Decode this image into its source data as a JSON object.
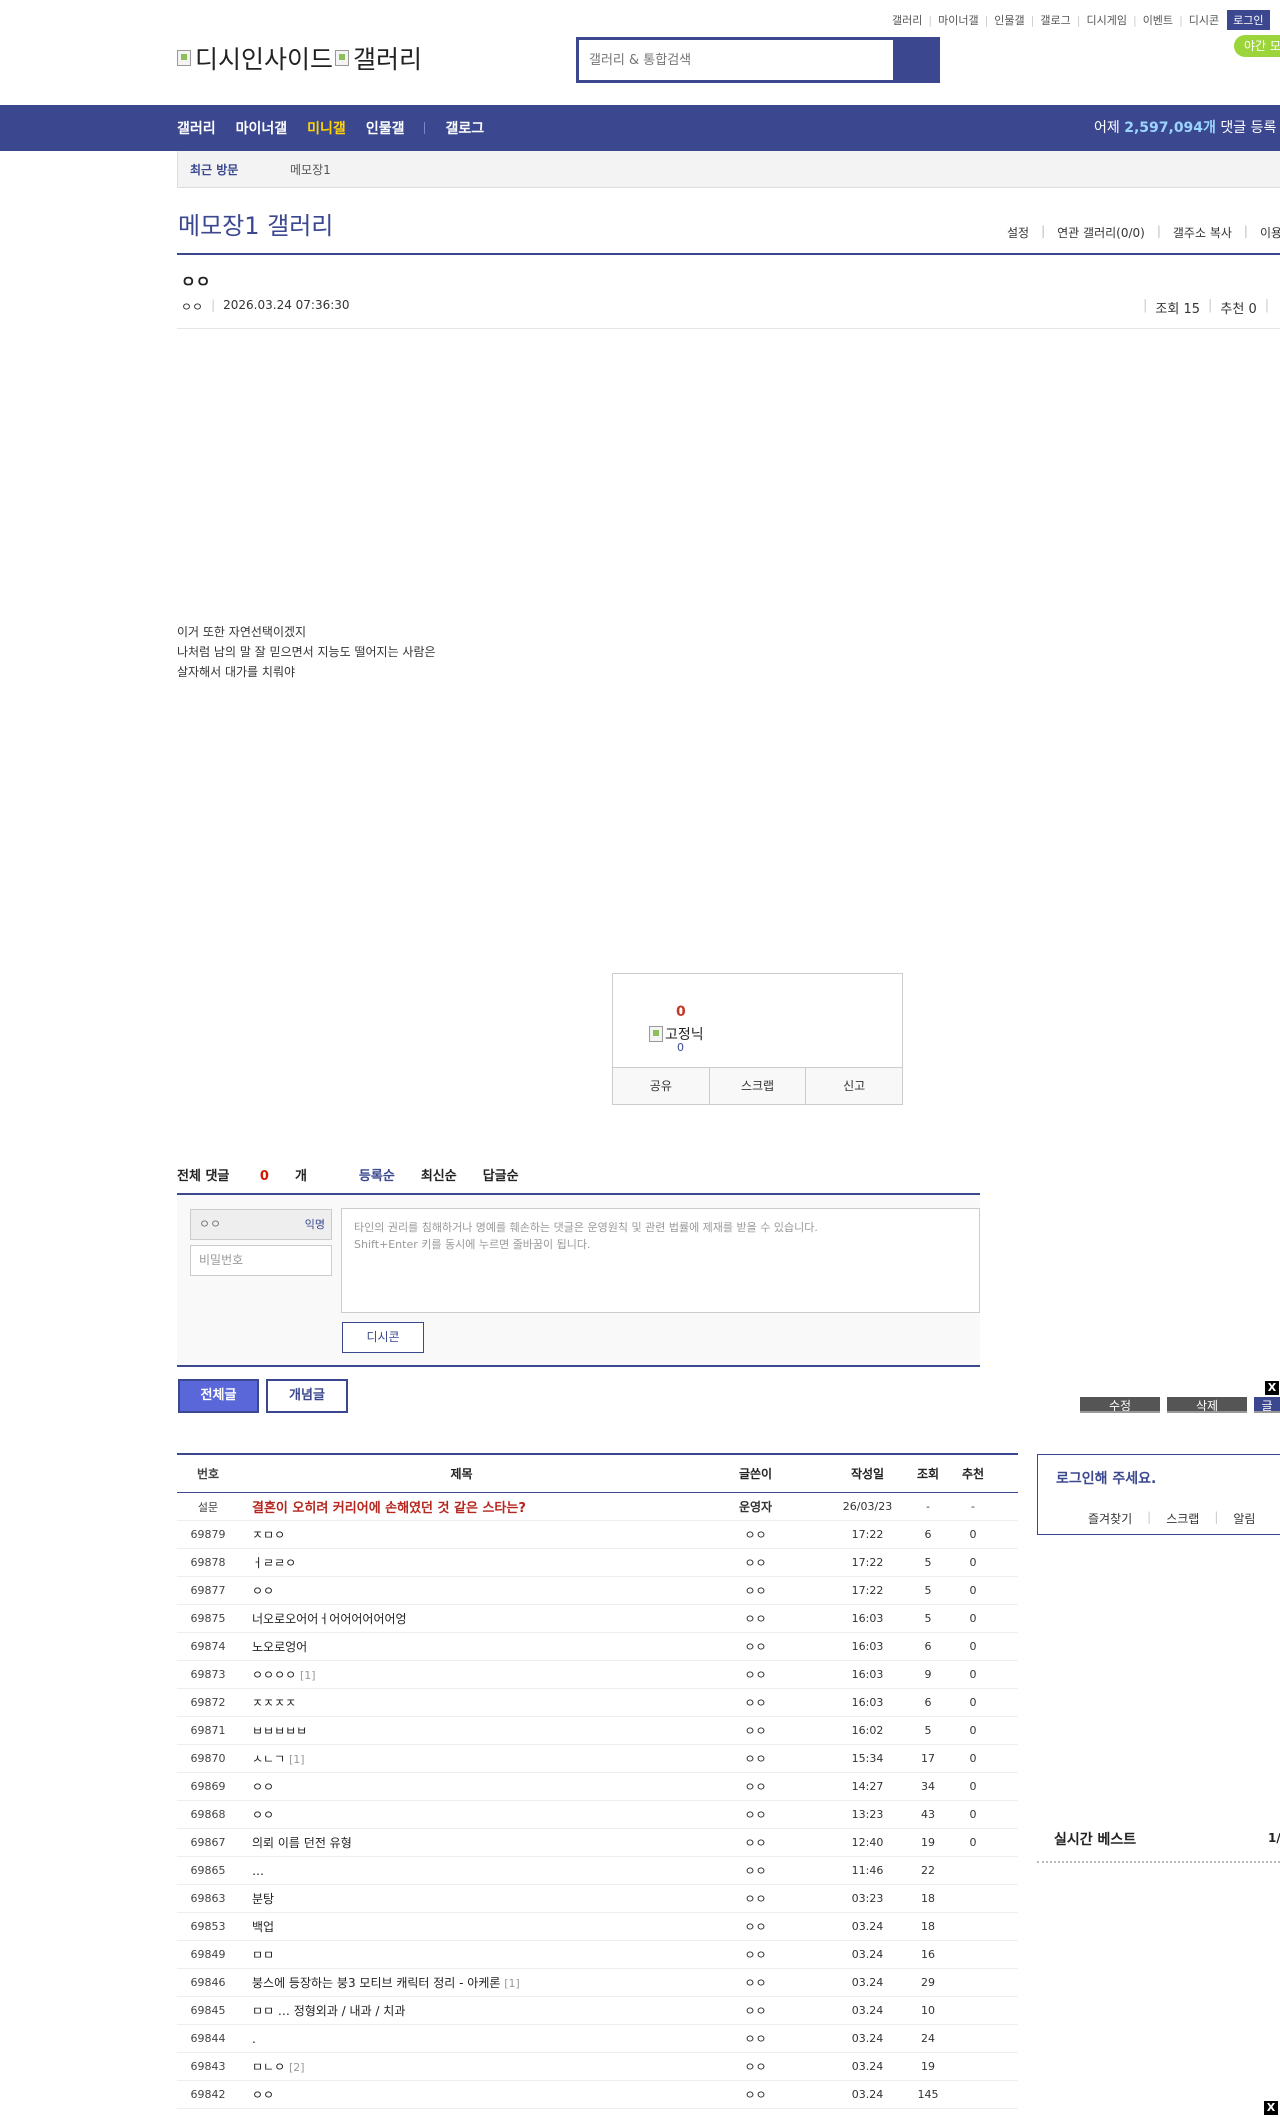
{
  "util_links": [
    "갤러리",
    "마이너갤",
    "인물갤",
    "갤로그",
    "디시게임",
    "이벤트",
    "디시콘"
  ],
  "login_label": "로그인",
  "night_label": "야간 모",
  "logo": {
    "alt1": "디시인사이드",
    "alt2": "갤러리"
  },
  "search": {
    "placeholder": "갤러리 & 통합검색"
  },
  "gnb": {
    "items": [
      "갤러리",
      "마이너갤",
      "미니갤",
      "인물갤",
      "갤로그"
    ],
    "active_index": 2,
    "stat_prefix": "어제 ",
    "stat_value": "2,597,094개",
    "stat_suffix": " 댓글 등록"
  },
  "visit": {
    "label": "최근 방문",
    "item": "메모장1"
  },
  "gallery": {
    "title": "메모장1 갤러리",
    "tools": [
      "설정",
      "연관 갤러리(0/0)",
      "갤주소 복사",
      "이용"
    ]
  },
  "post": {
    "title": "ㅇㅇ",
    "author": "ㅇㅇ",
    "date": "2026.03.24 07:36:30",
    "views": "조회 15",
    "recommends": "추천 0",
    "body": [
      "이거 또한 자연선택이겠지",
      "나처럼 남의 말 잘 믿으면서 지능도 떨어지는 사람은",
      "살자해서 대가를 치뤄야"
    ]
  },
  "recommend": {
    "count": "0",
    "image_alt": "고정닉",
    "sub_count": "0",
    "buttons": [
      "공유",
      "스크랩",
      "신고"
    ]
  },
  "comments": {
    "total_label": "전체 댓글 ",
    "total_count": "0",
    "total_suffix": "개",
    "sorts": [
      "등록순",
      "최신순",
      "답글순"
    ],
    "name_value": "ㅇㅇ",
    "anon_label": "익명",
    "password_placeholder": "비밀번호",
    "textarea_line1": "타인의 권리를 침해하거나 명예를 훼손하는 댓글은 운영원칙 및 관련 법률에 제재를 받을 수 있습니다.",
    "textarea_line2": "Shift+Enter 키를 동시에 누르면 줄바꿈이 됩니다.",
    "dccon_label": "디시콘"
  },
  "list_buttons": {
    "all": "전체글",
    "recommended": "개념글"
  },
  "action_buttons": [
    "수정",
    "삭제",
    "글"
  ],
  "table": {
    "headers": {
      "num": "번호",
      "subject": "제목",
      "writer": "글쓴이",
      "date": "작성일",
      "views": "조회",
      "rec": "추천"
    },
    "notice": {
      "num": "설문",
      "subject": "결혼이 오히려 커리어에 손해였던 것 같은 스타는?",
      "writer": "운영자",
      "date": "26/03/23",
      "views": "-",
      "rec": "-"
    },
    "rows": [
      {
        "num": "69879",
        "subject": "ㅈㅁㅇ",
        "reply": "",
        "writer": "ㅇㅇ",
        "date": "17:22",
        "views": "6",
        "rec": "0"
      },
      {
        "num": "69878",
        "subject": "ㅓㄹㄹㅇ",
        "reply": "",
        "writer": "ㅇㅇ",
        "date": "17:22",
        "views": "5",
        "rec": "0"
      },
      {
        "num": "69877",
        "subject": "ㅇㅇ",
        "reply": "",
        "writer": "ㅇㅇ",
        "date": "17:22",
        "views": "5",
        "rec": "0"
      },
      {
        "num": "69875",
        "subject": "너오로오어어ㅓ어어어어어어엉",
        "reply": "",
        "writer": "ㅇㅇ",
        "date": "16:03",
        "views": "5",
        "rec": "0"
      },
      {
        "num": "69874",
        "subject": "노오로엉어",
        "reply": "",
        "writer": "ㅇㅇ",
        "date": "16:03",
        "views": "6",
        "rec": "0"
      },
      {
        "num": "69873",
        "subject": "ㅇㅇㅇㅇ",
        "reply": "[1]",
        "writer": "ㅇㅇ",
        "date": "16:03",
        "views": "9",
        "rec": "0"
      },
      {
        "num": "69872",
        "subject": "ㅈㅈㅈㅈ",
        "reply": "",
        "writer": "ㅇㅇ",
        "date": "16:03",
        "views": "6",
        "rec": "0"
      },
      {
        "num": "69871",
        "subject": "ㅂㅂㅂㅂㅂ",
        "reply": "",
        "writer": "ㅇㅇ",
        "date": "16:02",
        "views": "5",
        "rec": "0"
      },
      {
        "num": "69870",
        "subject": "ㅅㄴㄱ",
        "reply": "[1]",
        "writer": "ㅇㅇ",
        "date": "15:34",
        "views": "17",
        "rec": "0"
      },
      {
        "num": "69869",
        "subject": "ㅇㅇ",
        "reply": "",
        "writer": "ㅇㅇ",
        "date": "14:27",
        "views": "34",
        "rec": "0"
      },
      {
        "num": "69868",
        "subject": "ㅇㅇ",
        "reply": "",
        "writer": "ㅇㅇ",
        "date": "13:23",
        "views": "43",
        "rec": "0"
      },
      {
        "num": "69867",
        "subject": "의뢰 이름 던전 유형",
        "reply": "",
        "writer": "ㅇㅇ",
        "date": "12:40",
        "views": "19",
        "rec": "0"
      },
      {
        "num": "69865",
        "subject": "…",
        "reply": "",
        "writer": "ㅇㅇ",
        "date": "11:46",
        "views": "22",
        "rec": ""
      },
      {
        "num": "69863",
        "subject": "분탕",
        "reply": "",
        "writer": "ㅇㅇ",
        "date": "03:23",
        "views": "18",
        "rec": ""
      },
      {
        "num": "69853",
        "subject": "백업",
        "reply": "",
        "writer": "ㅇㅇ",
        "date": "03.24",
        "views": "18",
        "rec": ""
      },
      {
        "num": "69849",
        "subject": "ㅁㅁ",
        "reply": "",
        "writer": "ㅇㅇ",
        "date": "03.24",
        "views": "16",
        "rec": ""
      },
      {
        "num": "69846",
        "subject": "붕스에 등장하는 붕3 모티브 캐릭터 정리 - 아케론",
        "reply": "[1]",
        "writer": "ㅇㅇ",
        "date": "03.24",
        "views": "29",
        "rec": ""
      },
      {
        "num": "69845",
        "subject": "ㅁㅁ … 정형외과 / 내과 / 치과",
        "reply": "",
        "writer": "ㅇㅇ",
        "date": "03.24",
        "views": "10",
        "rec": ""
      },
      {
        "num": "69844",
        "subject": ".",
        "reply": "",
        "writer": "ㅇㅇ",
        "date": "03.24",
        "views": "24",
        "rec": ""
      },
      {
        "num": "69843",
        "subject": "ㅁㄴㅇ",
        "reply": "[2]",
        "writer": "ㅇㅇ",
        "date": "03.24",
        "views": "19",
        "rec": ""
      },
      {
        "num": "69842",
        "subject": "ㅇㅇ",
        "reply": "",
        "writer": "ㅇㅇ",
        "date": "03.24",
        "views": "145",
        "rec": ""
      }
    ]
  },
  "sidebar": {
    "login_prompt": "로그인해 주세요.",
    "links": [
      "즐겨찾기",
      "스크랩",
      "알림"
    ],
    "best_title": "실시간 베스트",
    "best_page": "1/"
  },
  "close_label": "X"
}
